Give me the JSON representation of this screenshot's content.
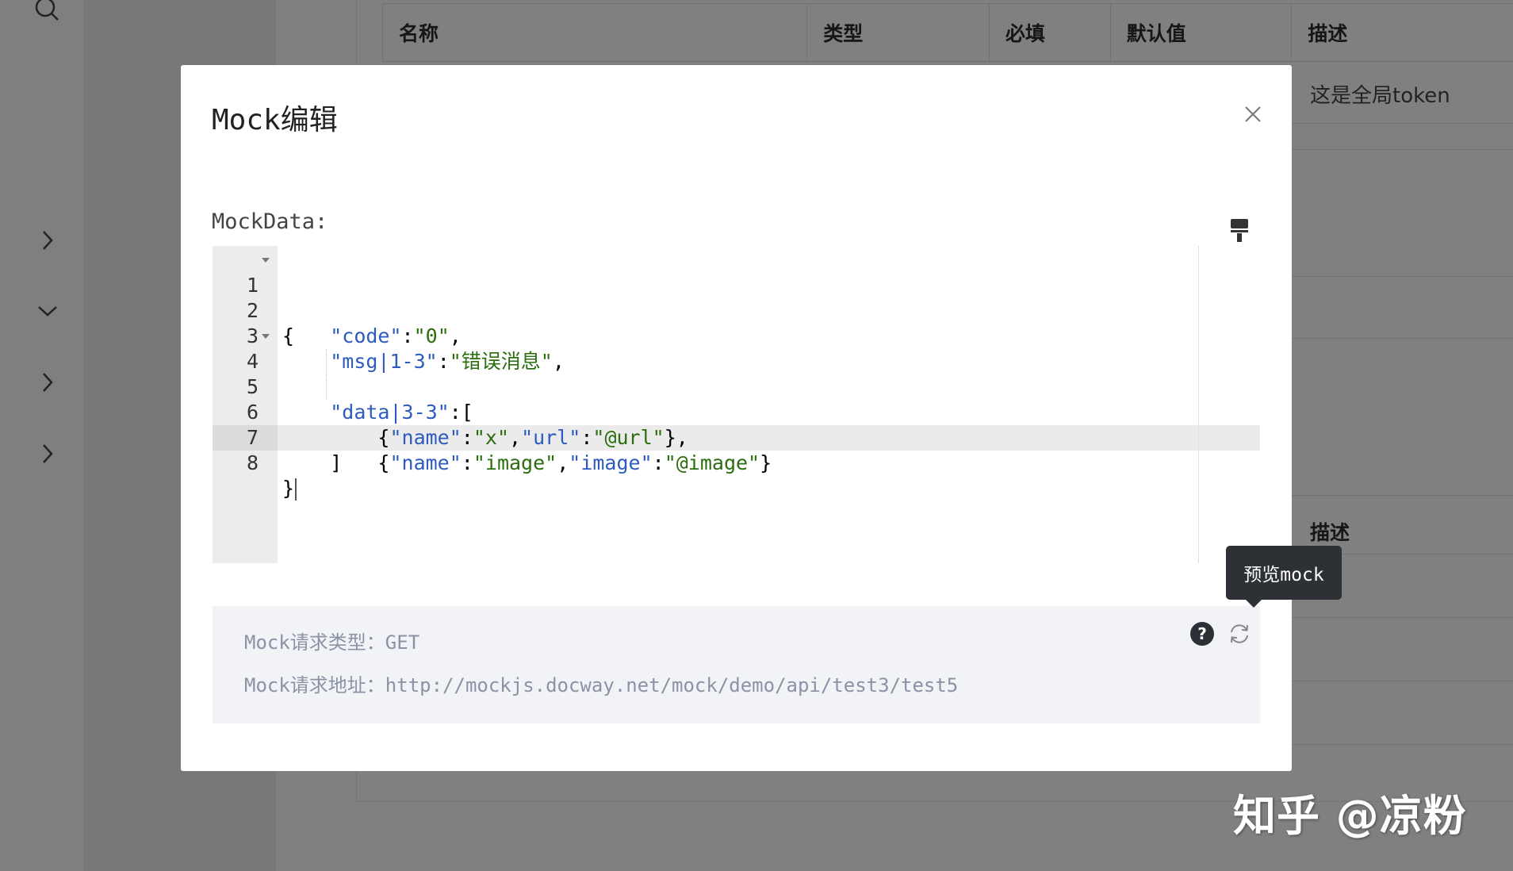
{
  "background": {
    "table1": {
      "headers": [
        "名称",
        "类型",
        "必填",
        "默认值",
        "描述"
      ],
      "row1_desc": "这是全局token"
    },
    "table2": {
      "header_desc": "描述"
    }
  },
  "modal": {
    "title": "Mock编辑",
    "mockdata_label": "MockData:",
    "code_lines": [
      "{",
      "    \"code\":\"0\",",
      "    \"msg|1-3\":\"错误消息\",",
      "    \"data|3-3\":[",
      "        {\"name\":\"x\",\"url\":\"@url\"},",
      "        {\"name\":\"image\",\"image\":\"@image\"}",
      "    ]",
      "}"
    ],
    "line_numbers": [
      "1",
      "2",
      "3",
      "4",
      "5",
      "6",
      "7",
      "8"
    ],
    "info": {
      "request_type_label": "Mock请求类型：",
      "request_type": "GET",
      "request_url_label": "Mock请求地址：",
      "request_url": "http://mockjs.docway.net/mock/demo/api/test3/test5"
    },
    "help_symbol": "?",
    "tooltip": "预览mock"
  },
  "watermark": "知乎 @凉粉",
  "icons": {
    "sidebar": [
      "search-icon",
      "chevron-right-icon",
      "chevron-down-icon",
      "chevron-right-icon",
      "chevron-right-icon"
    ],
    "modal": [
      "close-icon",
      "format-brush-icon",
      "help-icon",
      "refresh-icon"
    ]
  },
  "colors": {
    "overlay": "#808080",
    "modal_bg": "#ffffff",
    "json_key": "#2d5bbf",
    "json_string": "#2b6e0f",
    "tooltip_bg": "#2d3035",
    "info_bg": "#f2f3f7"
  }
}
